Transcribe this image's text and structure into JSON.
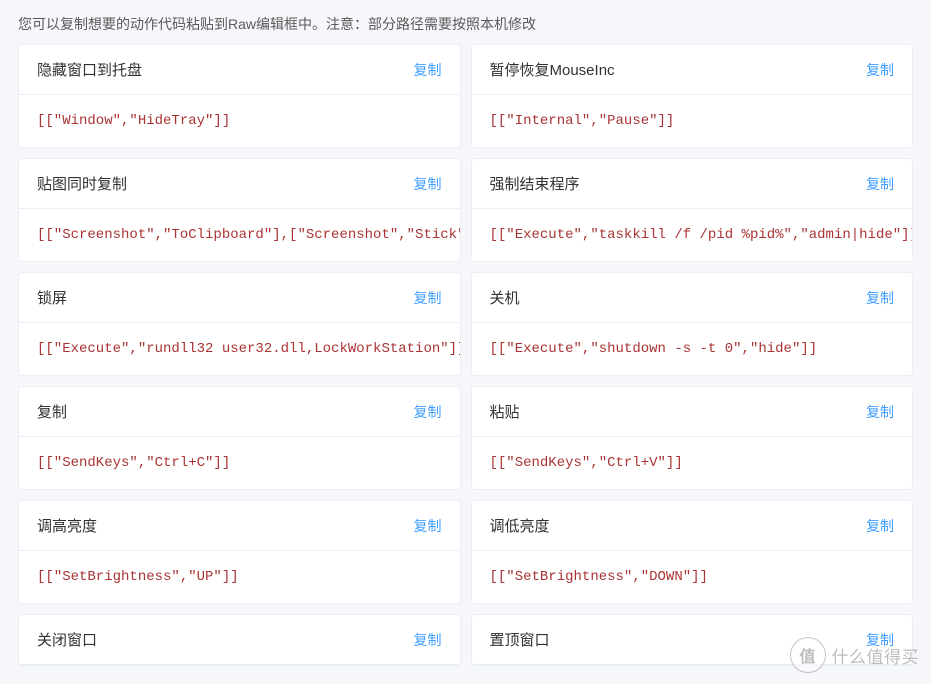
{
  "description": "您可以复制想要的动作代码粘贴到Raw编辑框中。注意：部分路径需要按照本机修改",
  "copy_label": "复制",
  "cards": [
    {
      "title": "隐藏窗口到托盘",
      "code": "[[\"Window\",\"HideTray\"]]"
    },
    {
      "title": "暂停恢复MouseInc",
      "code": "[[\"Internal\",\"Pause\"]]"
    },
    {
      "title": "贴图同时复制",
      "code": "[[\"Screenshot\",\"ToClipboard\"],[\"Screenshot\",\"Stick\"]]"
    },
    {
      "title": "强制结束程序",
      "code": "[[\"Execute\",\"taskkill /f /pid %pid%\",\"admin|hide\"]]"
    },
    {
      "title": "锁屏",
      "code": "[[\"Execute\",\"rundll32 user32.dll,LockWorkStation\"]]"
    },
    {
      "title": "关机",
      "code": "[[\"Execute\",\"shutdown -s -t 0\",\"hide\"]]"
    },
    {
      "title": "复制",
      "code": "[[\"SendKeys\",\"Ctrl+C\"]]"
    },
    {
      "title": "粘贴",
      "code": "[[\"SendKeys\",\"Ctrl+V\"]]"
    },
    {
      "title": "调高亮度",
      "code": "[[\"SetBrightness\",\"UP\"]]"
    },
    {
      "title": "调低亮度",
      "code": "[[\"SetBrightness\",\"DOWN\"]]"
    },
    {
      "title": "关闭窗口",
      "code": ""
    },
    {
      "title": "置顶窗口",
      "code": ""
    }
  ],
  "watermark": {
    "logo": "值",
    "text": "什么值得买"
  }
}
